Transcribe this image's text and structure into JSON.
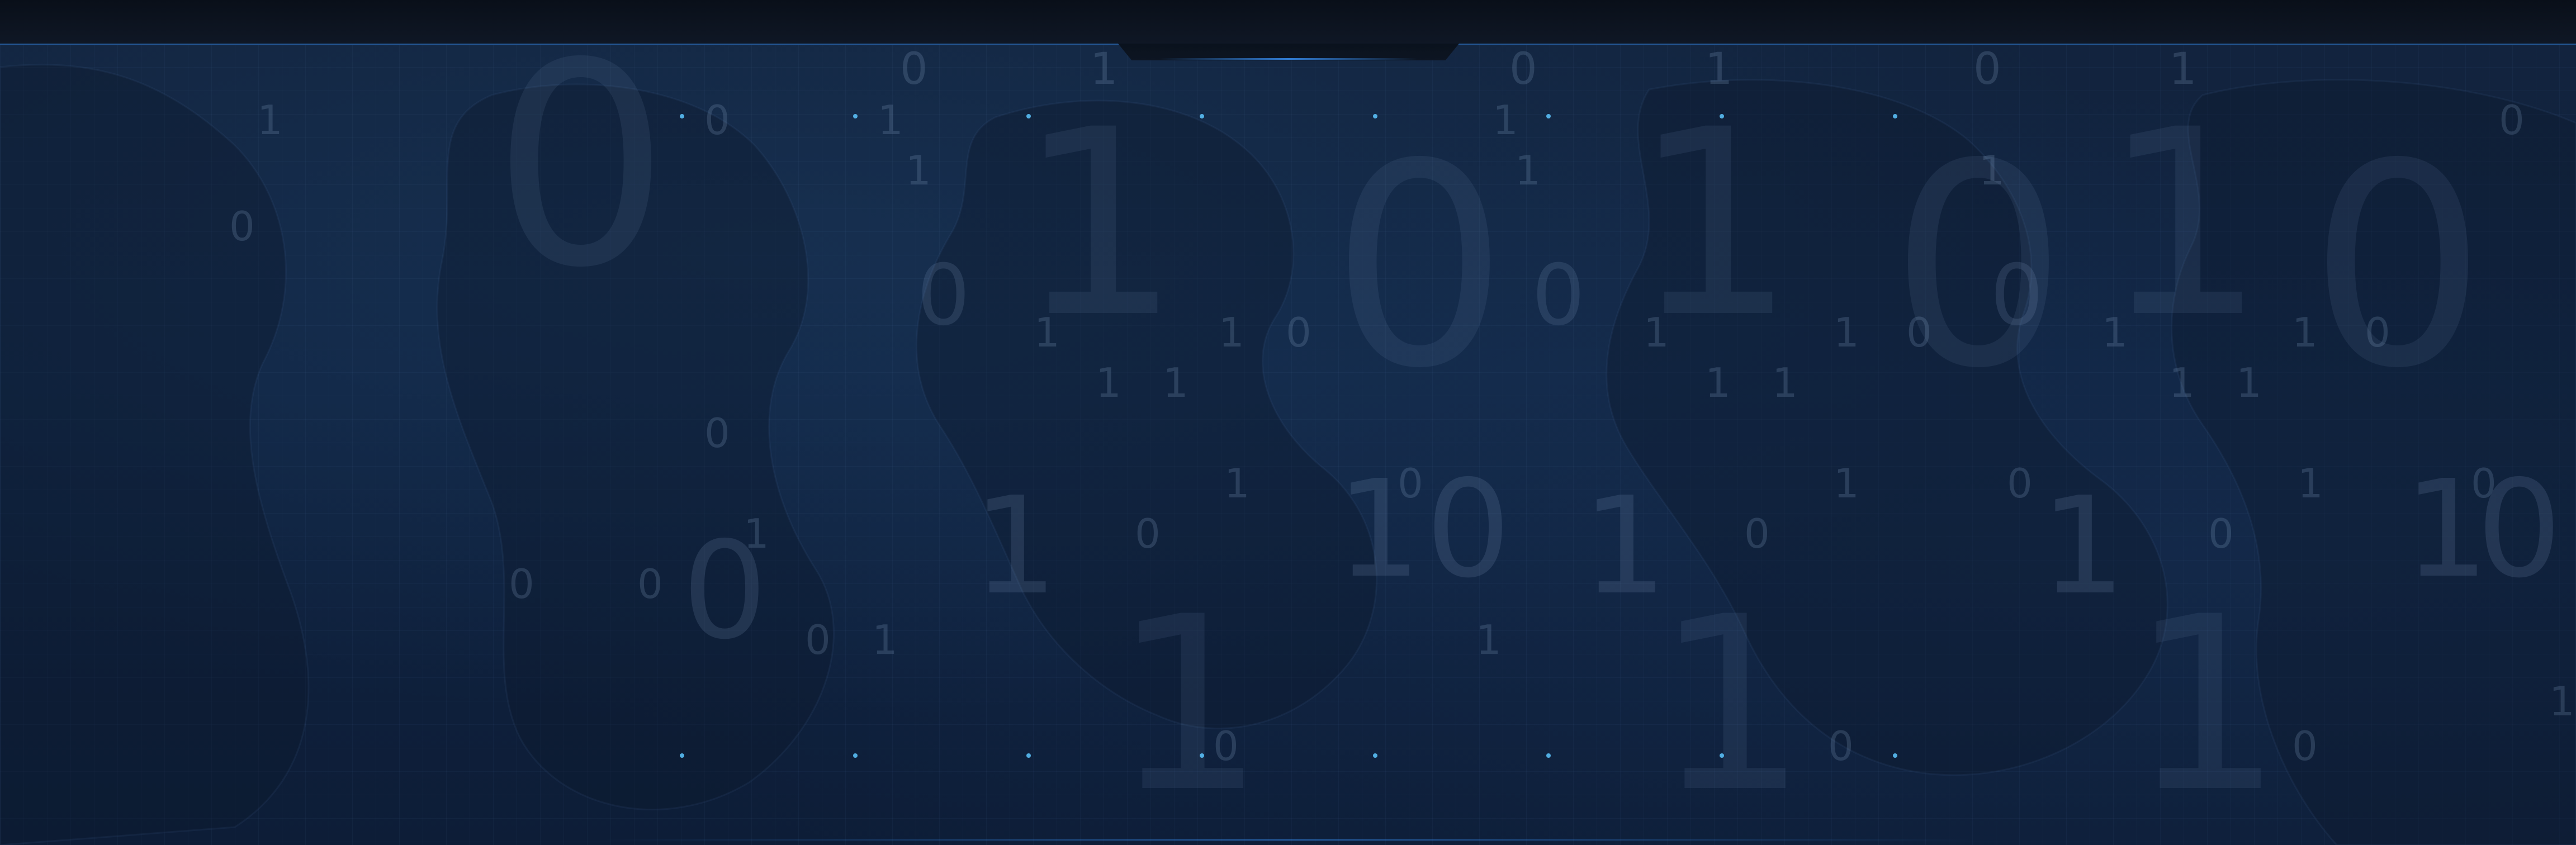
{
  "background": {
    "base_color": "#102442",
    "accent_color": "#3a96ff"
  },
  "digits": [
    "0",
    "1"
  ],
  "code_snippet": {
    "visible": true,
    "text_lines": []
  }
}
